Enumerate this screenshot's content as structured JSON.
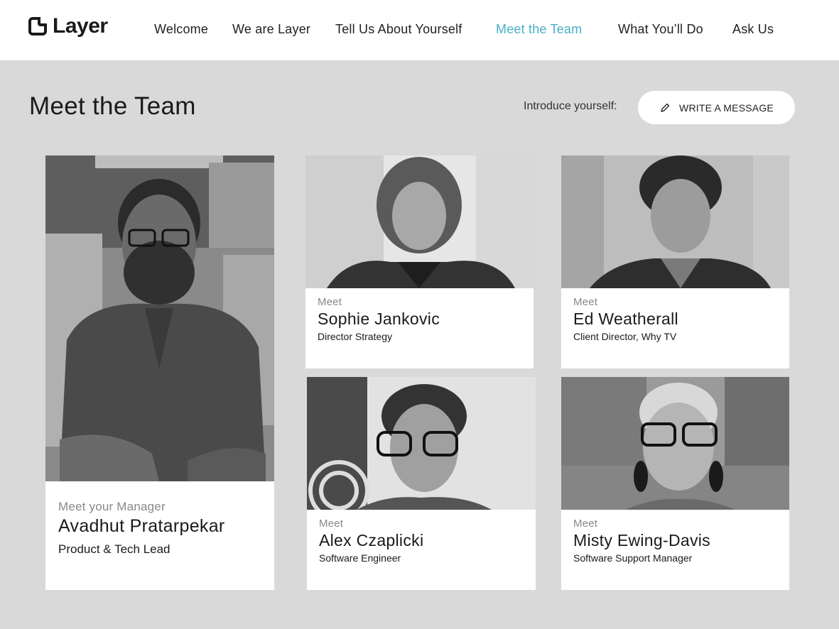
{
  "header": {
    "logo_text": "Layer",
    "nav": [
      {
        "label": "Welcome",
        "active": false
      },
      {
        "label": "We are Layer",
        "active": false
      },
      {
        "label": "Tell Us About Yourself",
        "active": false
      },
      {
        "label": "Meet the Team",
        "active": true
      },
      {
        "label": "What You’ll Do",
        "active": false
      },
      {
        "label": "Ask Us",
        "active": false
      }
    ],
    "accent_color": "#4aaec8"
  },
  "main": {
    "title": "Meet the Team",
    "intro_label": "Introduce yourself:",
    "write_button_label": "WRITE A MESSAGE",
    "write_button_icon": "pencil-icon"
  },
  "manager": {
    "meet_label": "Meet your Manager",
    "name": "Avadhut Pratarpekar",
    "role": "Product & Tech Lead"
  },
  "team": [
    {
      "meet_label": "Meet",
      "name": "Sophie Jankovic",
      "role": "Director Strategy"
    },
    {
      "meet_label": "Meet",
      "name": "Ed Weatherall",
      "role": "Client Director, Why TV"
    },
    {
      "meet_label": "Meet",
      "name": "Alex Czaplicki",
      "role": "Software Engineer"
    },
    {
      "meet_label": "Meet",
      "name": "Misty Ewing-Davis",
      "role": "Software Support Manager"
    }
  ]
}
